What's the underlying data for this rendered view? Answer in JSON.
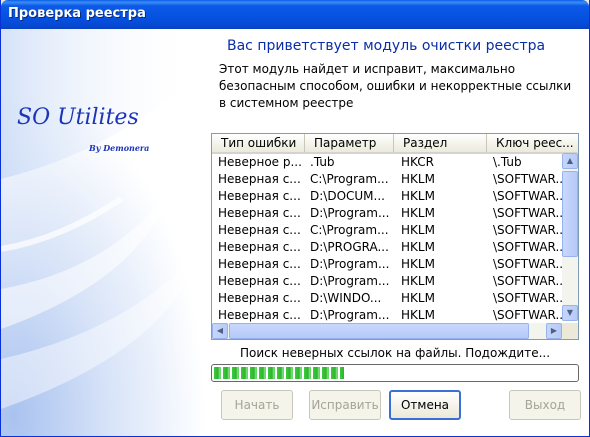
{
  "window": {
    "title": "Проверка реестра"
  },
  "brand": {
    "name": "SO Utilites",
    "byline": "By Demonera"
  },
  "heading": "Вас приветствует модуль очистки реестра",
  "description": "Этот модуль найдет и исправит, максимально безопасным способом, ошибки и некорректные ссылки в системном реестре",
  "table": {
    "columns": [
      "Тип ошибки",
      "Параметр",
      "Раздел",
      "Ключ реес..."
    ],
    "rows": [
      [
        "Неверное р...",
        ".Tub",
        "HKCR",
        "\\.Tub"
      ],
      [
        "Неверная с...",
        "C:\\Program...",
        "HKLM",
        "\\SOFTWAR..."
      ],
      [
        "Неверная с...",
        "D:\\DOCUM...",
        "HKLM",
        "\\SOFTWAR..."
      ],
      [
        "Неверная с...",
        "D:\\Program...",
        "HKLM",
        "\\SOFTWAR..."
      ],
      [
        "Неверная с...",
        "C:\\Program...",
        "HKLM",
        "\\SOFTWAR..."
      ],
      [
        "Неверная с...",
        "D:\\PROGRA...",
        "HKLM",
        "\\SOFTWAR..."
      ],
      [
        "Неверная с...",
        "D:\\Program...",
        "HKLM",
        "\\SOFTWAR..."
      ],
      [
        "Неверная с...",
        "D:\\Program...",
        "HKLM",
        "\\SOFTWAR..."
      ],
      [
        "Неверная с...",
        "D:\\WINDO...",
        "HKLM",
        "\\SOFTWAR..."
      ],
      [
        "Неверная с...",
        "D:\\Program...",
        "HKLM",
        "\\SOFTWAR..."
      ]
    ]
  },
  "status_text": "Поиск неверных ссылок на файлы. Подождите...",
  "progress": {
    "percent": 36,
    "color": "#2db52d"
  },
  "buttons": {
    "start": "Начать",
    "fix": "Исправить",
    "cancel": "Отмена",
    "exit": "Выход"
  },
  "colors": {
    "title_bar": "#0551e0",
    "brand": "#1b34b8",
    "heading": "#0b2ea8"
  }
}
